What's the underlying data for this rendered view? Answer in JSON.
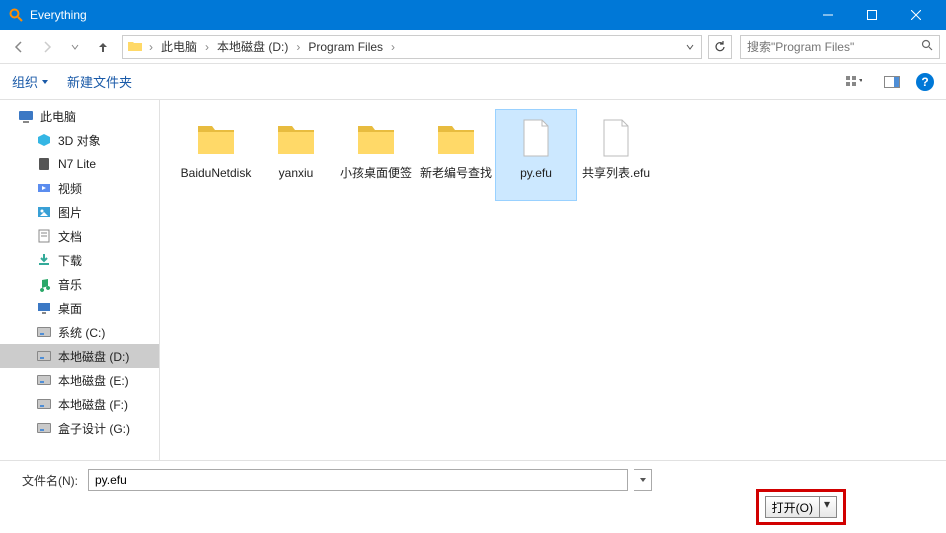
{
  "window": {
    "title": "Everything"
  },
  "nav": {
    "breadcrumb": [
      "此电脑",
      "本地磁盘 (D:)",
      "Program Files"
    ]
  },
  "search": {
    "placeholder": "搜索\"Program Files\""
  },
  "toolbar": {
    "organize": "组织",
    "newfolder": "新建文件夹"
  },
  "sidebar": {
    "items": [
      {
        "label": "此电脑",
        "icon": "pc"
      },
      {
        "label": "3D 对象",
        "icon": "3d",
        "indent": true
      },
      {
        "label": "N7 Lite",
        "icon": "dev",
        "indent": true
      },
      {
        "label": "视频",
        "icon": "video",
        "indent": true
      },
      {
        "label": "图片",
        "icon": "pic",
        "indent": true
      },
      {
        "label": "文档",
        "icon": "doc",
        "indent": true
      },
      {
        "label": "下载",
        "icon": "dl",
        "indent": true
      },
      {
        "label": "音乐",
        "icon": "music",
        "indent": true
      },
      {
        "label": "桌面",
        "icon": "desk",
        "indent": true
      },
      {
        "label": "系统 (C:)",
        "icon": "drive",
        "indent": true
      },
      {
        "label": "本地磁盘 (D:)",
        "icon": "drive",
        "indent": true,
        "selected": true
      },
      {
        "label": "本地磁盘 (E:)",
        "icon": "drive",
        "indent": true
      },
      {
        "label": "本地磁盘 (F:)",
        "icon": "drive",
        "indent": true
      },
      {
        "label": "盒子设计 (G:)",
        "icon": "drive",
        "indent": true
      }
    ]
  },
  "files": [
    {
      "label": "BaiduNetdisk",
      "type": "folder"
    },
    {
      "label": "yanxiu",
      "type": "folder"
    },
    {
      "label": "小孩桌面便签",
      "type": "folder"
    },
    {
      "label": "新老编号查找",
      "type": "folder"
    },
    {
      "label": "py.efu",
      "type": "file",
      "selected": true
    },
    {
      "label": "共享列表.efu",
      "type": "file"
    }
  ],
  "footer": {
    "filename_label": "文件名(N):",
    "filename_value": "py.efu",
    "open_label": "打开(O)"
  }
}
